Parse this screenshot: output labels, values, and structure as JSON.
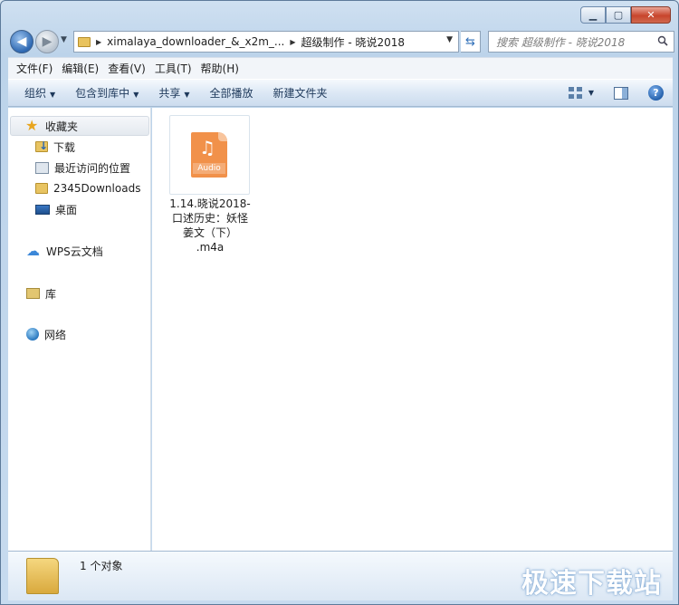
{
  "window": {
    "caption_buttons": [
      "minimize",
      "maximize",
      "close"
    ]
  },
  "address_bar": {
    "crumbs": [
      "ximalaya_downloader_&_x2m_...",
      "超级制作 - 晓说2018"
    ]
  },
  "search": {
    "placeholder": "搜索 超级制作 - 晓说2018"
  },
  "menu": {
    "items": [
      "文件(F)",
      "编辑(E)",
      "查看(V)",
      "工具(T)",
      "帮助(H)"
    ]
  },
  "commands": {
    "organize": "组织",
    "include_library": "包含到库中",
    "share": "共享",
    "play_all": "全部播放",
    "new_folder": "新建文件夹"
  },
  "nav": {
    "favorites": "收藏夹",
    "downloads": "下载",
    "recent": "最近访问的位置",
    "folder_2345": "2345Downloads",
    "desktop": "桌面",
    "wps_cloud": "WPS云文档",
    "library": "库",
    "network": "网络"
  },
  "files": [
    {
      "icon_label": "Audio",
      "name": "1.14.晓说2018-口述历史：妖怪姜文（下）.m4a",
      "name_lines": [
        "1.14.晓说2018-",
        "口述历史：妖怪",
        "姜文（下）",
        ".m4a"
      ]
    }
  ],
  "status": {
    "count": "1 个对象",
    "watermark": "极速下载站"
  }
}
